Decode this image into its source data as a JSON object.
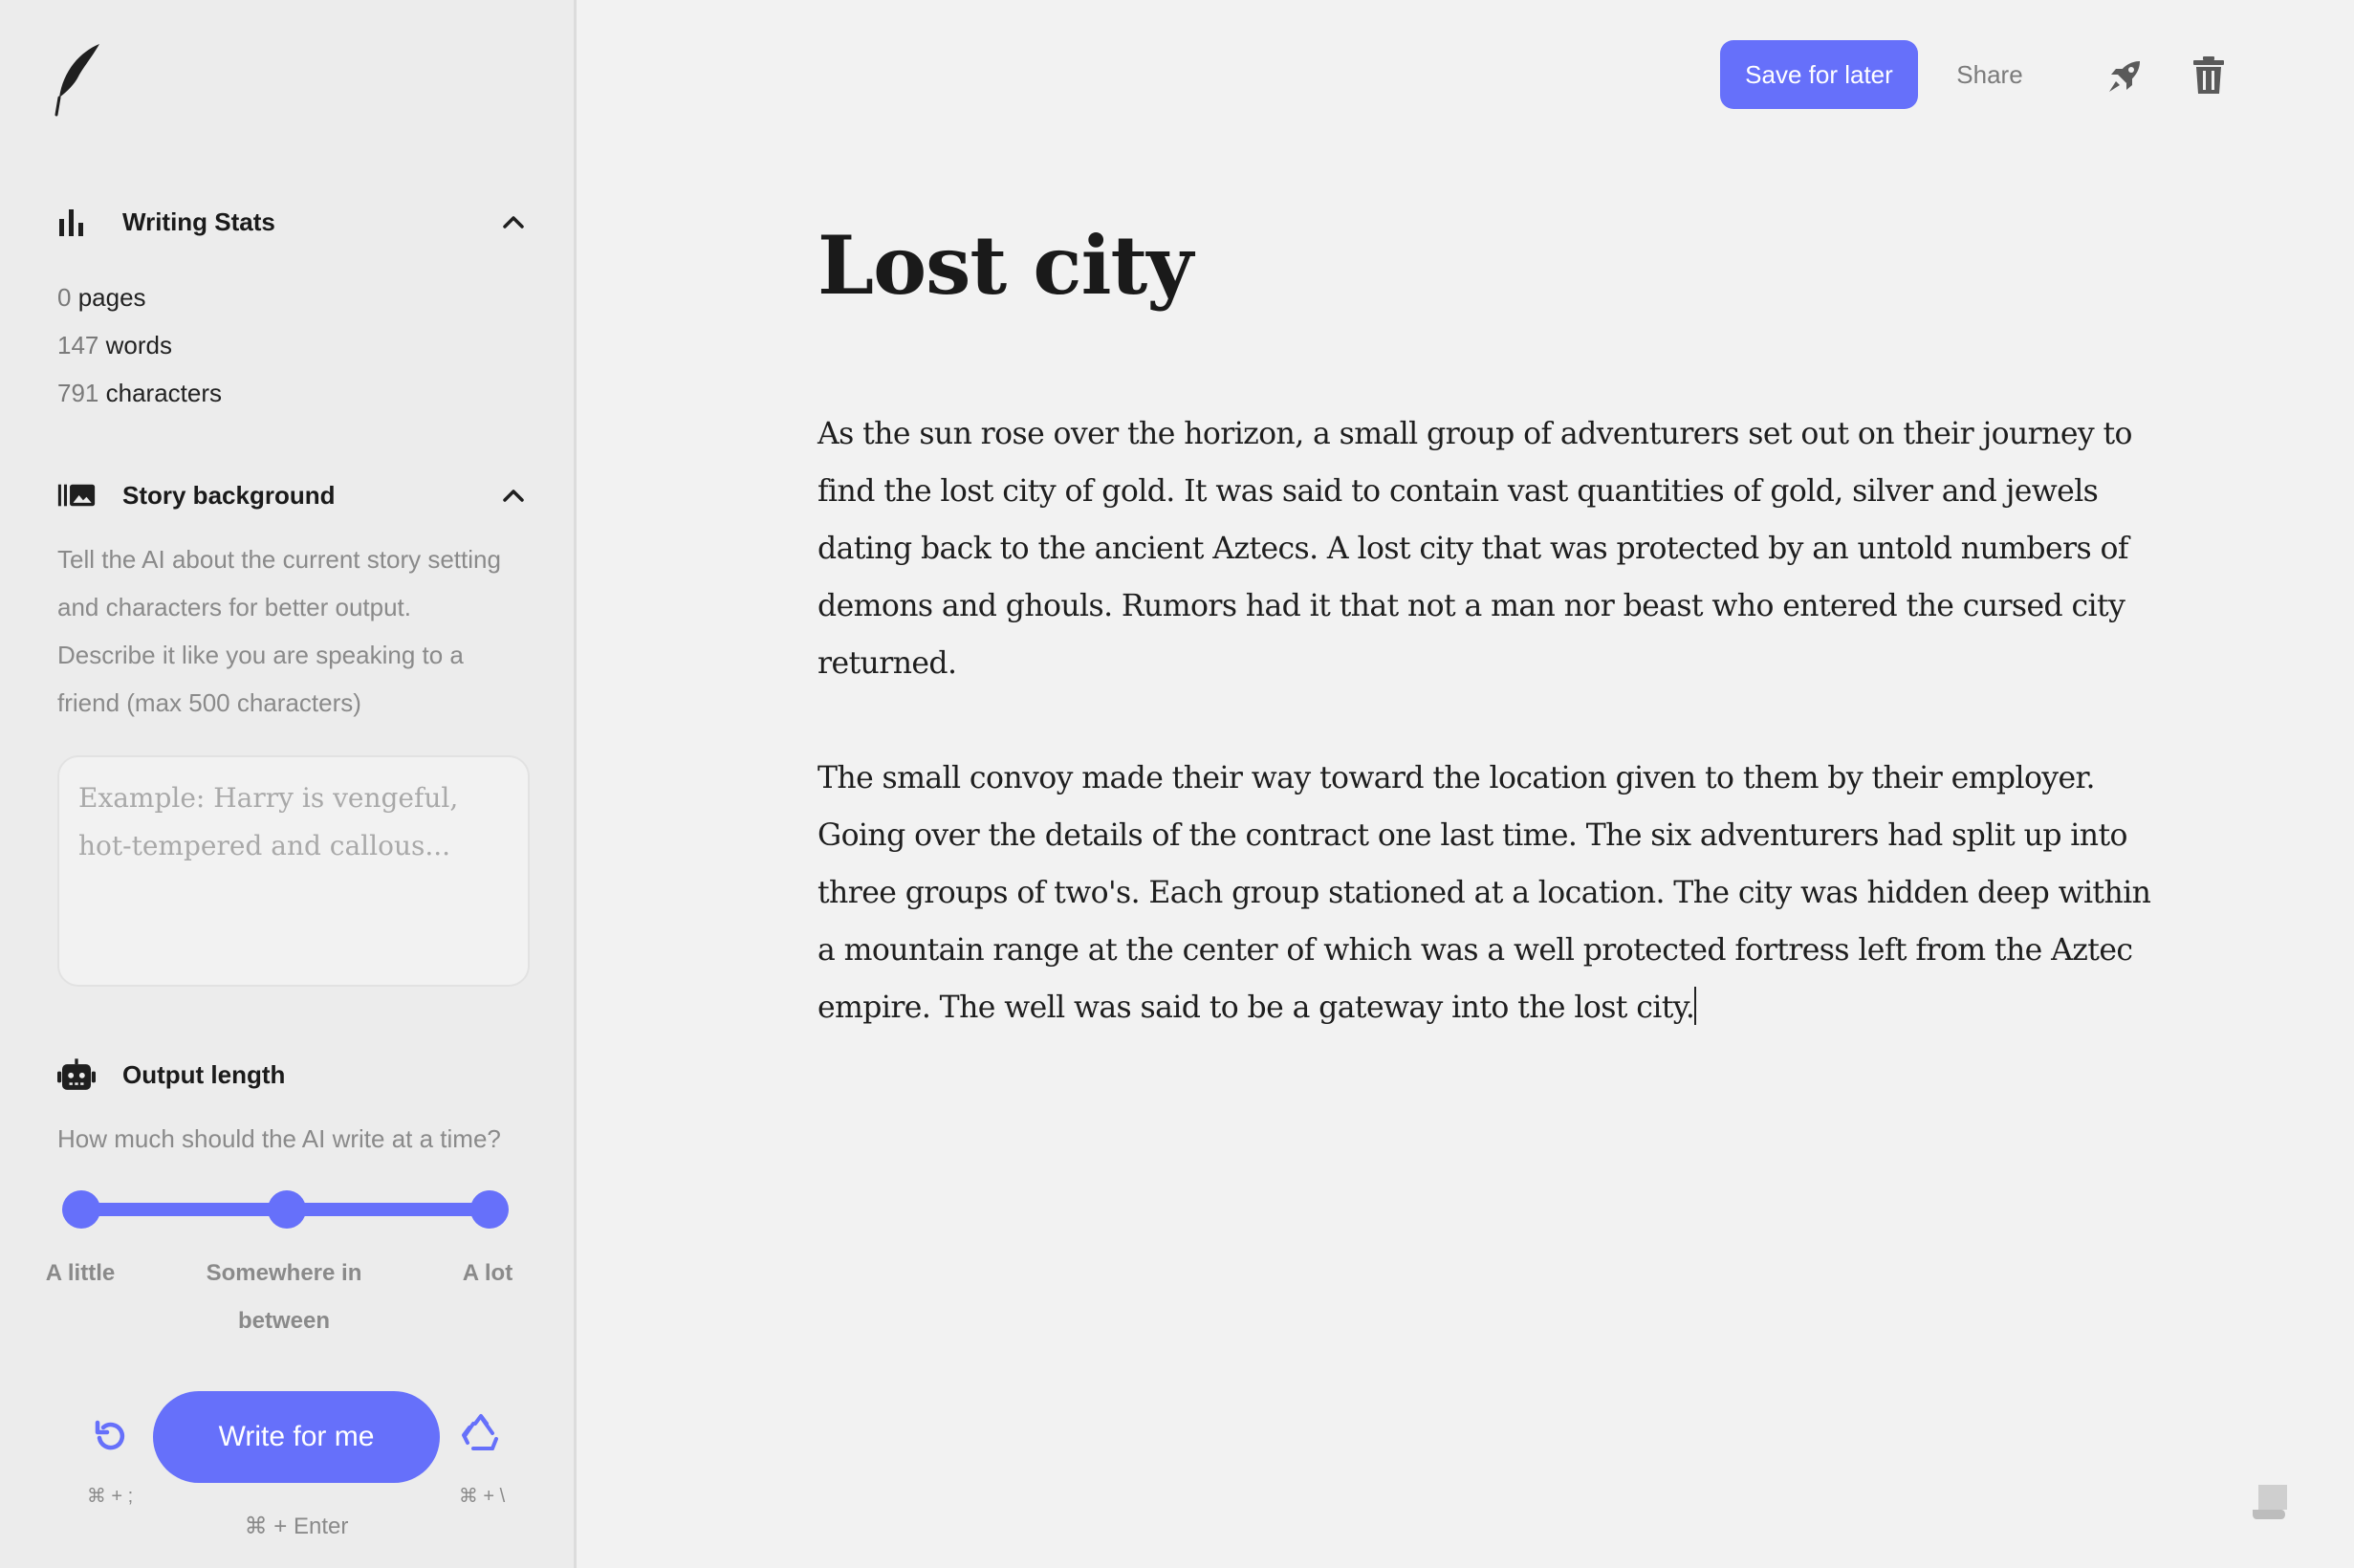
{
  "sidebar": {
    "writing_stats": {
      "title": "Writing Stats",
      "pages_value": "0",
      "pages_label": "pages",
      "words_value": "147",
      "words_label": "words",
      "characters_value": "791",
      "characters_label": "characters"
    },
    "story_background": {
      "title": "Story background",
      "description_lines": [
        "Tell the AI about the current story setting",
        "and characters for better output.",
        "Describe it like you are speaking to a",
        "friend (max 500 characters)"
      ],
      "placeholder": "Example: Harry is vengeful, hot-tempered and callous..."
    },
    "output_length": {
      "title": "Output length",
      "question": "How much should the AI write at a time?",
      "options": [
        "A little",
        "Somewhere in",
        "between",
        "A lot"
      ]
    },
    "actions": {
      "write_label": "Write for me",
      "write_shortcut": "⌘ + Enter",
      "undo_shortcut": "⌘ + ;",
      "retry_shortcut": "⌘ + \\"
    }
  },
  "toolbar": {
    "save_label": "Save for later",
    "share_label": "Share"
  },
  "document": {
    "title": "Lost city",
    "paragraphs": [
      "As the sun rose over the horizon, a small group of adventurers set out on their journey to find the lost city of gold. It was said to contain vast quantities of gold, silver and jewels dating back to the ancient Aztecs. A lost city that was protected by an untold numbers of demons and ghouls. Rumors had it that not a man nor beast who entered the cursed city returned.",
      "The small convoy made their way toward the location given to them by their employer. Going over the details of the contract one last time. The six adventurers had split up into three groups of two's. Each group stationed at a location. The city was hidden deep within a mountain range at the center of which was a well protected fortress left from the Aztec empire. The well was said to be a gateway into the lost city."
    ]
  },
  "colors": {
    "accent": "#6670fa",
    "sidebar_bg": "#ececec",
    "main_bg": "#f2f2f2"
  },
  "icons": [
    "feather-logo-icon",
    "bar-chart-icon",
    "chevron-up-icon",
    "image-panel-icon",
    "robot-icon",
    "undo-icon",
    "recycle-icon",
    "rocket-icon",
    "trash-icon",
    "scroll-icon"
  ]
}
